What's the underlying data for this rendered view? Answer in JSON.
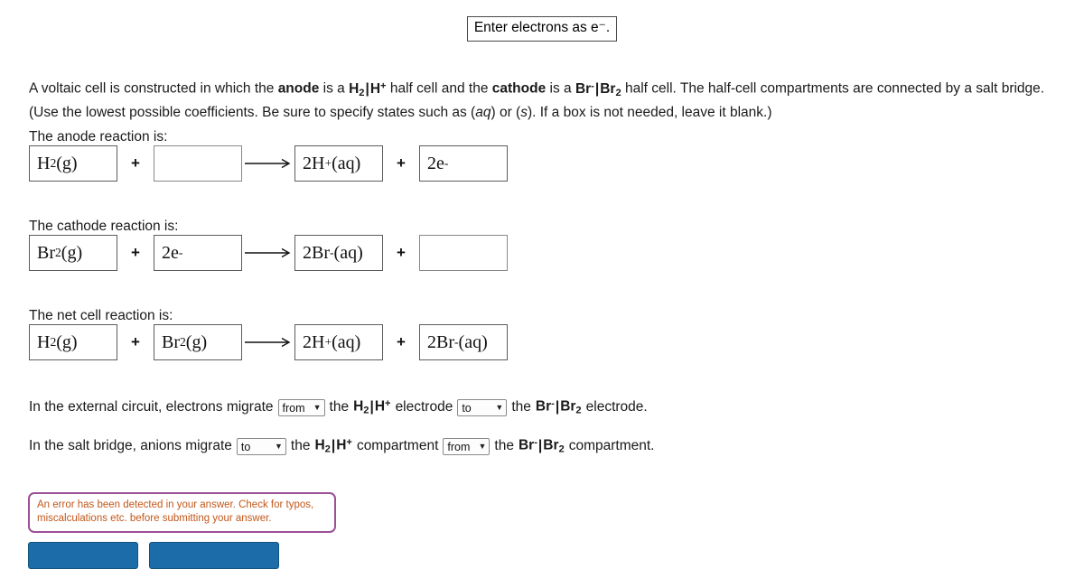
{
  "hint": {
    "text": "Enter electrons as e⁻."
  },
  "prompt": {
    "line1_a": "A voltaic cell is constructed in which the ",
    "line1_anode": "anode",
    "line1_b": " is a ",
    "line1_anode_cell": "H2|H+",
    "line1_c": " half cell and the ",
    "line1_cathode": "cathode",
    "line1_d": " is a ",
    "line1_cathode_cell": "Br⁻|Br2",
    "line1_e": " half cell. The half-cell compartments are connected by a salt bridge.",
    "line2_a": "(Use the lowest possible coefficients. Be sure to specify states such as (",
    "line2_aq": "aq",
    "line2_b": ") or (",
    "line2_s": "s",
    "line2_c": "). If a box is not needed, leave it blank.)"
  },
  "anode": {
    "label": "The anode reaction is:",
    "reactant1": "H2(g)",
    "reactant2": "",
    "product1": "2H+(aq)",
    "product2": "2e⁻",
    "plus": "+",
    "arrow": "⟶"
  },
  "cathode": {
    "label": "The cathode reaction is:",
    "reactant1": "Br2(g)",
    "reactant2": "2e⁻",
    "product1": "2Br⁻(aq)",
    "product2": "",
    "plus": "+",
    "arrow": "⟶"
  },
  "net": {
    "label": "The net cell reaction is:",
    "reactant1": "H2(g)",
    "reactant2": "Br2(g)",
    "product1": "2H+(aq)",
    "product2": "2Br⁻(aq)",
    "plus": "+",
    "arrow": "⟶"
  },
  "external_circuit": {
    "text_a": "In the external circuit, electrons migrate",
    "select1_value": "from",
    "text_b": "the",
    "electrode1": "H2|H+",
    "text_c": "electrode",
    "select2_value": "to",
    "text_d": "the",
    "electrode2": "Br⁻|Br2",
    "text_e": "electrode."
  },
  "salt_bridge": {
    "text_a": "In the salt bridge, anions migrate",
    "select1_value": "to",
    "text_b": "the",
    "compartment1": "H2|H+",
    "text_c": "compartment",
    "select2_value": "from",
    "text_d": "the",
    "compartment2": "Br⁻|Br2",
    "text_e": "compartment."
  },
  "error": {
    "line1": "An error has been detected in your answer. Check for typos,",
    "line2": "miscalculations etc. before submitting your answer."
  },
  "select_options": [
    "from",
    "to"
  ],
  "colors": {
    "error_border": "#9b4f96",
    "error_text": "#c2571a",
    "button": "#1b6ca8",
    "box_border_filled": "#5c5c5c",
    "box_border_empty": "#888888"
  },
  "buttons": {
    "submit_label": "",
    "retry_label": ""
  }
}
